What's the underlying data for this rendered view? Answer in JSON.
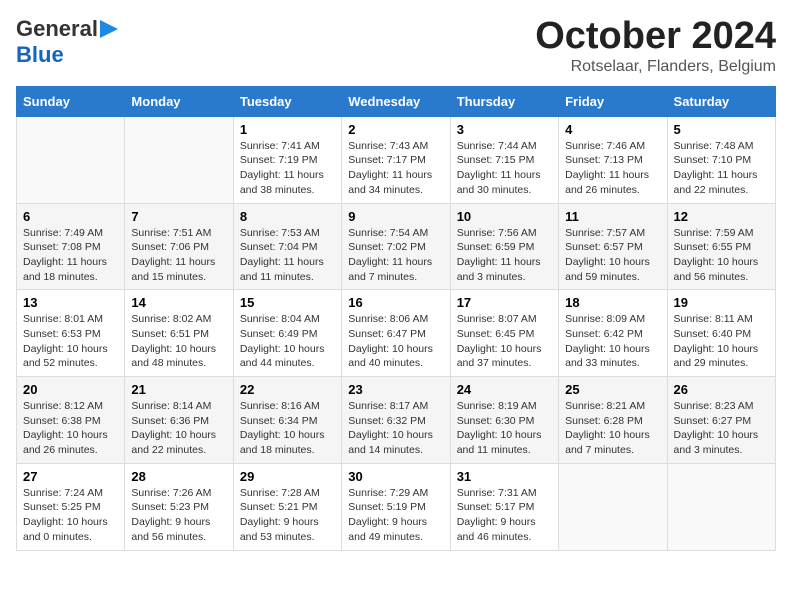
{
  "header": {
    "logo_general": "General",
    "logo_blue": "Blue",
    "month_title": "October 2024",
    "location": "Rotselaar, Flanders, Belgium"
  },
  "weekdays": [
    "Sunday",
    "Monday",
    "Tuesday",
    "Wednesday",
    "Thursday",
    "Friday",
    "Saturday"
  ],
  "weeks": [
    [
      {
        "day": "",
        "sunrise": "",
        "sunset": "",
        "daylight": ""
      },
      {
        "day": "",
        "sunrise": "",
        "sunset": "",
        "daylight": ""
      },
      {
        "day": "1",
        "sunrise": "Sunrise: 7:41 AM",
        "sunset": "Sunset: 7:19 PM",
        "daylight": "Daylight: 11 hours and 38 minutes."
      },
      {
        "day": "2",
        "sunrise": "Sunrise: 7:43 AM",
        "sunset": "Sunset: 7:17 PM",
        "daylight": "Daylight: 11 hours and 34 minutes."
      },
      {
        "day": "3",
        "sunrise": "Sunrise: 7:44 AM",
        "sunset": "Sunset: 7:15 PM",
        "daylight": "Daylight: 11 hours and 30 minutes."
      },
      {
        "day": "4",
        "sunrise": "Sunrise: 7:46 AM",
        "sunset": "Sunset: 7:13 PM",
        "daylight": "Daylight: 11 hours and 26 minutes."
      },
      {
        "day": "5",
        "sunrise": "Sunrise: 7:48 AM",
        "sunset": "Sunset: 7:10 PM",
        "daylight": "Daylight: 11 hours and 22 minutes."
      }
    ],
    [
      {
        "day": "6",
        "sunrise": "Sunrise: 7:49 AM",
        "sunset": "Sunset: 7:08 PM",
        "daylight": "Daylight: 11 hours and 18 minutes."
      },
      {
        "day": "7",
        "sunrise": "Sunrise: 7:51 AM",
        "sunset": "Sunset: 7:06 PM",
        "daylight": "Daylight: 11 hours and 15 minutes."
      },
      {
        "day": "8",
        "sunrise": "Sunrise: 7:53 AM",
        "sunset": "Sunset: 7:04 PM",
        "daylight": "Daylight: 11 hours and 11 minutes."
      },
      {
        "day": "9",
        "sunrise": "Sunrise: 7:54 AM",
        "sunset": "Sunset: 7:02 PM",
        "daylight": "Daylight: 11 hours and 7 minutes."
      },
      {
        "day": "10",
        "sunrise": "Sunrise: 7:56 AM",
        "sunset": "Sunset: 6:59 PM",
        "daylight": "Daylight: 11 hours and 3 minutes."
      },
      {
        "day": "11",
        "sunrise": "Sunrise: 7:57 AM",
        "sunset": "Sunset: 6:57 PM",
        "daylight": "Daylight: 10 hours and 59 minutes."
      },
      {
        "day": "12",
        "sunrise": "Sunrise: 7:59 AM",
        "sunset": "Sunset: 6:55 PM",
        "daylight": "Daylight: 10 hours and 56 minutes."
      }
    ],
    [
      {
        "day": "13",
        "sunrise": "Sunrise: 8:01 AM",
        "sunset": "Sunset: 6:53 PM",
        "daylight": "Daylight: 10 hours and 52 minutes."
      },
      {
        "day": "14",
        "sunrise": "Sunrise: 8:02 AM",
        "sunset": "Sunset: 6:51 PM",
        "daylight": "Daylight: 10 hours and 48 minutes."
      },
      {
        "day": "15",
        "sunrise": "Sunrise: 8:04 AM",
        "sunset": "Sunset: 6:49 PM",
        "daylight": "Daylight: 10 hours and 44 minutes."
      },
      {
        "day": "16",
        "sunrise": "Sunrise: 8:06 AM",
        "sunset": "Sunset: 6:47 PM",
        "daylight": "Daylight: 10 hours and 40 minutes."
      },
      {
        "day": "17",
        "sunrise": "Sunrise: 8:07 AM",
        "sunset": "Sunset: 6:45 PM",
        "daylight": "Daylight: 10 hours and 37 minutes."
      },
      {
        "day": "18",
        "sunrise": "Sunrise: 8:09 AM",
        "sunset": "Sunset: 6:42 PM",
        "daylight": "Daylight: 10 hours and 33 minutes."
      },
      {
        "day": "19",
        "sunrise": "Sunrise: 8:11 AM",
        "sunset": "Sunset: 6:40 PM",
        "daylight": "Daylight: 10 hours and 29 minutes."
      }
    ],
    [
      {
        "day": "20",
        "sunrise": "Sunrise: 8:12 AM",
        "sunset": "Sunset: 6:38 PM",
        "daylight": "Daylight: 10 hours and 26 minutes."
      },
      {
        "day": "21",
        "sunrise": "Sunrise: 8:14 AM",
        "sunset": "Sunset: 6:36 PM",
        "daylight": "Daylight: 10 hours and 22 minutes."
      },
      {
        "day": "22",
        "sunrise": "Sunrise: 8:16 AM",
        "sunset": "Sunset: 6:34 PM",
        "daylight": "Daylight: 10 hours and 18 minutes."
      },
      {
        "day": "23",
        "sunrise": "Sunrise: 8:17 AM",
        "sunset": "Sunset: 6:32 PM",
        "daylight": "Daylight: 10 hours and 14 minutes."
      },
      {
        "day": "24",
        "sunrise": "Sunrise: 8:19 AM",
        "sunset": "Sunset: 6:30 PM",
        "daylight": "Daylight: 10 hours and 11 minutes."
      },
      {
        "day": "25",
        "sunrise": "Sunrise: 8:21 AM",
        "sunset": "Sunset: 6:28 PM",
        "daylight": "Daylight: 10 hours and 7 minutes."
      },
      {
        "day": "26",
        "sunrise": "Sunrise: 8:23 AM",
        "sunset": "Sunset: 6:27 PM",
        "daylight": "Daylight: 10 hours and 3 minutes."
      }
    ],
    [
      {
        "day": "27",
        "sunrise": "Sunrise: 7:24 AM",
        "sunset": "Sunset: 5:25 PM",
        "daylight": "Daylight: 10 hours and 0 minutes."
      },
      {
        "day": "28",
        "sunrise": "Sunrise: 7:26 AM",
        "sunset": "Sunset: 5:23 PM",
        "daylight": "Daylight: 9 hours and 56 minutes."
      },
      {
        "day": "29",
        "sunrise": "Sunrise: 7:28 AM",
        "sunset": "Sunset: 5:21 PM",
        "daylight": "Daylight: 9 hours and 53 minutes."
      },
      {
        "day": "30",
        "sunrise": "Sunrise: 7:29 AM",
        "sunset": "Sunset: 5:19 PM",
        "daylight": "Daylight: 9 hours and 49 minutes."
      },
      {
        "day": "31",
        "sunrise": "Sunrise: 7:31 AM",
        "sunset": "Sunset: 5:17 PM",
        "daylight": "Daylight: 9 hours and 46 minutes."
      },
      {
        "day": "",
        "sunrise": "",
        "sunset": "",
        "daylight": ""
      },
      {
        "day": "",
        "sunrise": "",
        "sunset": "",
        "daylight": ""
      }
    ]
  ]
}
